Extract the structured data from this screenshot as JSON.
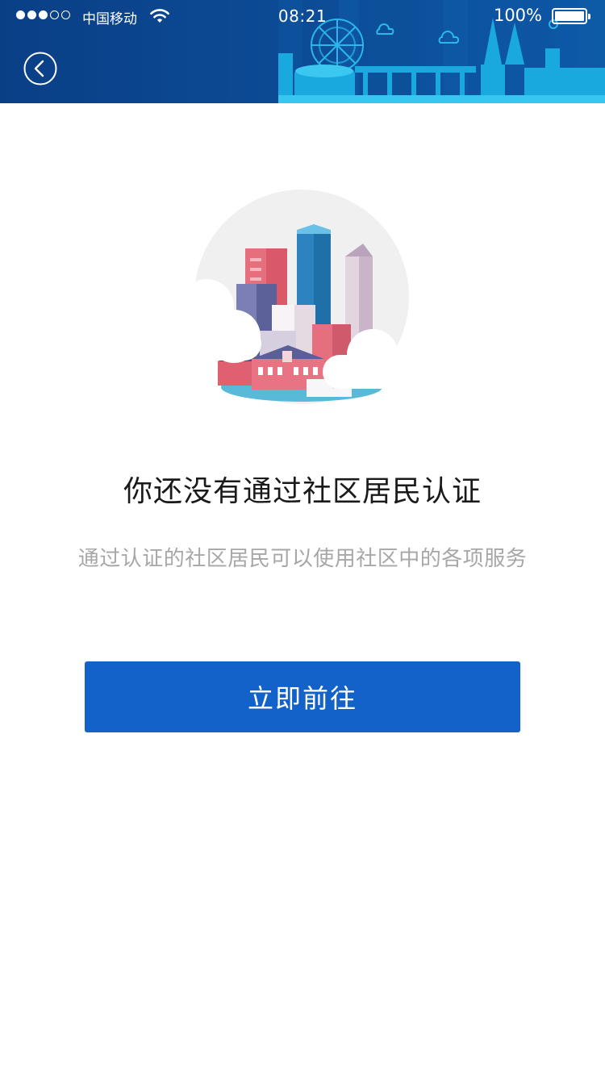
{
  "status_bar": {
    "carrier": "中国移动",
    "time": "08:21",
    "battery_percent": "100%",
    "signal_bars_filled": 3,
    "signal_bars_total": 5
  },
  "nav": {
    "back_icon": "chevron-left-circle-icon"
  },
  "content": {
    "illustration": "city-skyline-illustration",
    "title": "你还没有通过社区居民认证",
    "subtitle": "通过认证的社区居民可以使用社区中的各项服务",
    "action_label": "立即前往"
  },
  "colors": {
    "header_bg": "#0c4a95",
    "skyline_accent": "#19b6e6",
    "primary_button": "#1262c9",
    "title_text": "#1a1a1a",
    "subtitle_text": "#a7a7a7"
  }
}
